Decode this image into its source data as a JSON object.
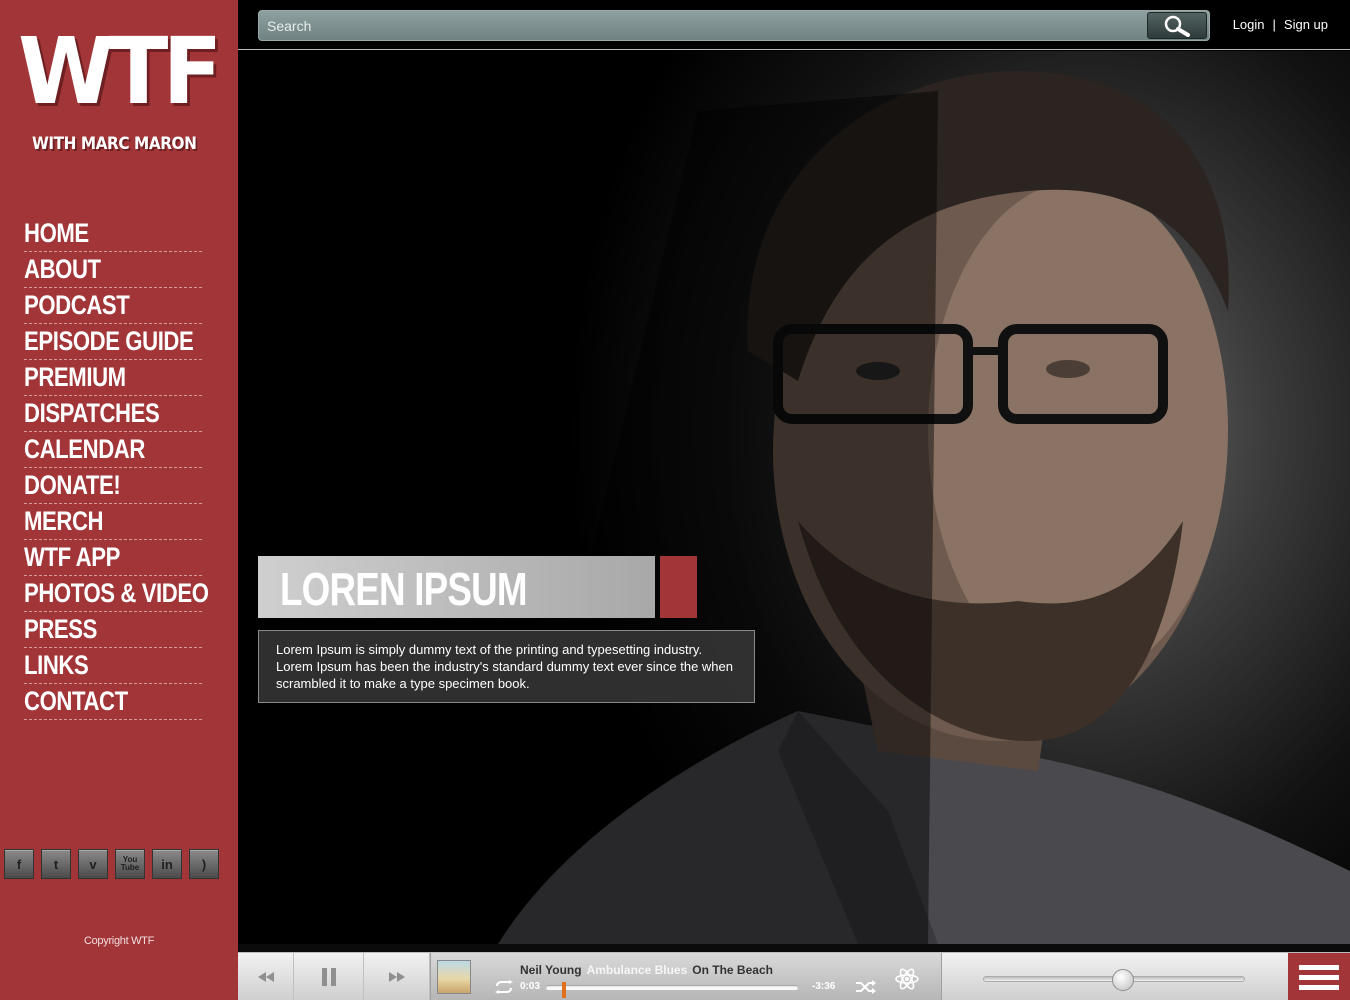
{
  "brand": {
    "logo_main": "WTF",
    "logo_sub": "WITH MARC MARON"
  },
  "nav": {
    "items": [
      {
        "label": "HOME"
      },
      {
        "label": "ABOUT"
      },
      {
        "label": "PODCAST"
      },
      {
        "label": "EPISODE GUIDE"
      },
      {
        "label": "PREMIUM"
      },
      {
        "label": "DISPATCHES"
      },
      {
        "label": "CALENDAR"
      },
      {
        "label": "DONATE!"
      },
      {
        "label": "MERCH"
      },
      {
        "label": "WTF APP"
      },
      {
        "label": "PHOTOS & VIDEO"
      },
      {
        "label": "PRESS"
      },
      {
        "label": "LINKS"
      },
      {
        "label": "CONTACT"
      }
    ]
  },
  "socials": [
    {
      "icon": "facebook-icon",
      "glyph": "f"
    },
    {
      "icon": "twitter-icon",
      "glyph": "t"
    },
    {
      "icon": "vimeo-icon",
      "glyph": "v"
    },
    {
      "icon": "youtube-icon",
      "glyph": "You Tube"
    },
    {
      "icon": "linkedin-icon",
      "glyph": "in"
    },
    {
      "icon": "rss-icon",
      "glyph": ")"
    }
  ],
  "footer": {
    "copyright": "Copyright WTF"
  },
  "search": {
    "placeholder": "Search"
  },
  "auth": {
    "login": "Login",
    "separator": "|",
    "signup": "Sign up"
  },
  "hero": {
    "headline": "LOREN IPSUM",
    "description": "Lorem Ipsum is simply dummy text of the printing and typesetting industry. Lorem Ipsum has been the industry's standard dummy text ever since the when scrambled it to make a type specimen book."
  },
  "player": {
    "artist": "Neil Young",
    "song": "Ambulance Blues",
    "album": "On The Beach",
    "time_current": "0:03",
    "time_remaining": "-3:36",
    "progress": 0.07,
    "volume": 0.53
  },
  "colors": {
    "sidebar": "#a13538",
    "accent": "#a13538",
    "progress_head": "#e0721f"
  }
}
